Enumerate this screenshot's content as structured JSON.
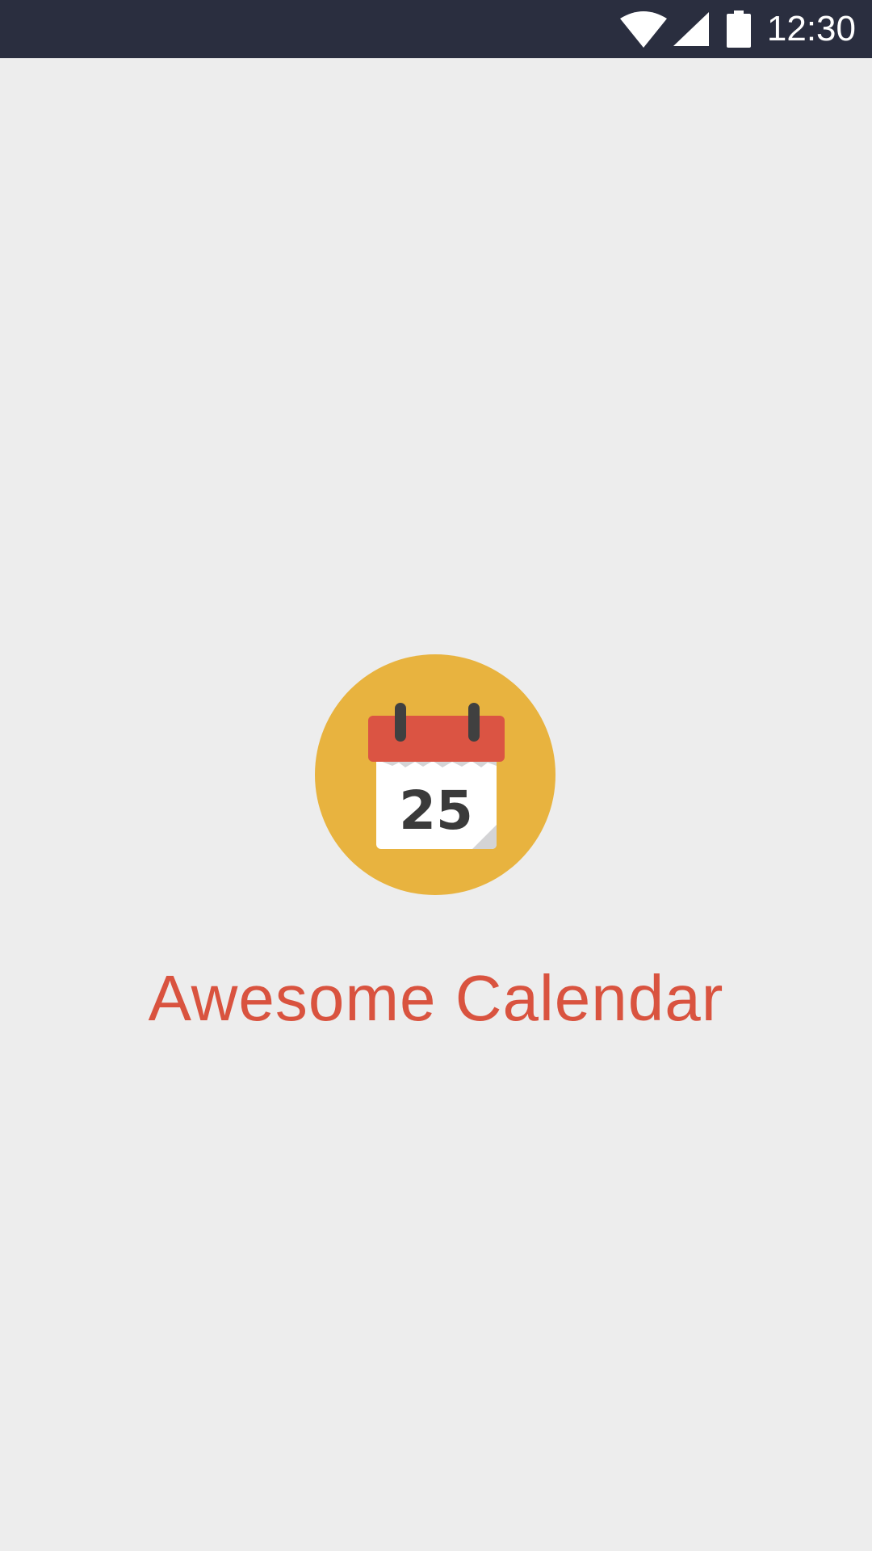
{
  "status_bar": {
    "time": "12:30",
    "icons": [
      "wifi-icon",
      "cellular-signal-icon",
      "battery-icon"
    ]
  },
  "splash": {
    "calendar_day": "25",
    "app_name": "Awesome Calendar"
  },
  "colors": {
    "status_bar_bg": "#2a2e3f",
    "background": "#ededed",
    "logo_circle": "#e8b33f",
    "calendar_header": "#db5443",
    "calendar_page": "#ffffff",
    "calendar_ring": "#404040",
    "title": "#d9533f"
  }
}
